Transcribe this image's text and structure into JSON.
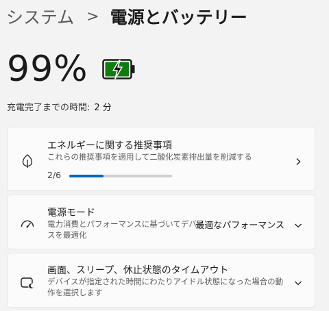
{
  "breadcrumb": {
    "parent": "システム",
    "separator": ">",
    "current": "電源とバッテリー"
  },
  "battery": {
    "percent_text": "99%",
    "level": 0.99,
    "charging": true,
    "icon": "battery-charging-icon",
    "color": "#107c10"
  },
  "charge_time": {
    "label": "充電完了までの時間:",
    "value": "2 分"
  },
  "cards": {
    "energy": {
      "icon": "leaf-icon",
      "title": "エネルギーに関する推奨事項",
      "description": "これらの推奨事項を適用して二酸化炭素排出量を削減する",
      "progress_text": "2/6",
      "progress_value": 0.333,
      "chevron": "chevron-right-icon"
    },
    "power_mode": {
      "icon": "gauge-icon",
      "title": "電源モード",
      "description": "電力消費とパフォーマンスに基づいてデバイスを最適化",
      "value": "最適なパフォーマンス",
      "chevron": "chevron-down-icon"
    },
    "sleep": {
      "icon": "screen-sleep-icon",
      "title": "画面、スリープ、休止状態のタイムアウト",
      "description": "デバイスが指定された時間にわたりアイドル状態になった場合の動作を選択します",
      "chevron": "chevron-down-icon"
    }
  },
  "colors": {
    "accent": "#0067c0",
    "battery_green": "#107c10"
  }
}
